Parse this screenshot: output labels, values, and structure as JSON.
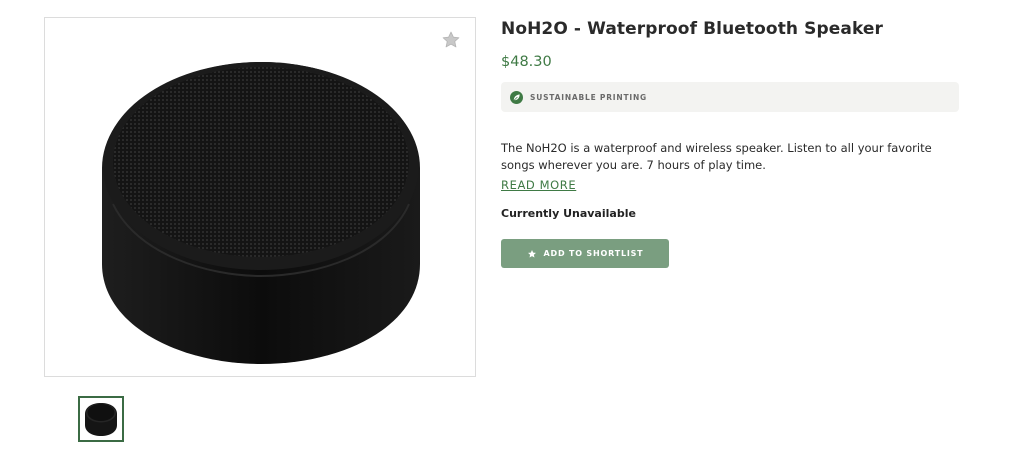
{
  "product": {
    "title": "NoH2O - Waterproof Bluetooth Speaker",
    "price": "$48.30",
    "badge": "SUSTAINABLE PRINTING",
    "description": "The NoH2O is a waterproof and wireless speaker.  Listen to all your favorite songs wherever you are. 7 hours of play time.",
    "read_more": "READ MORE",
    "availability": "Currently Unavailable",
    "shortlist_button": "ADD TO SHORTLIST"
  },
  "icons": {
    "favorite": "star-icon",
    "badge": "leaf-icon",
    "button": "star-icon"
  },
  "colors": {
    "accent": "#3f7a45",
    "button": "#7a9e80",
    "badge_bg": "#f3f3f1"
  }
}
